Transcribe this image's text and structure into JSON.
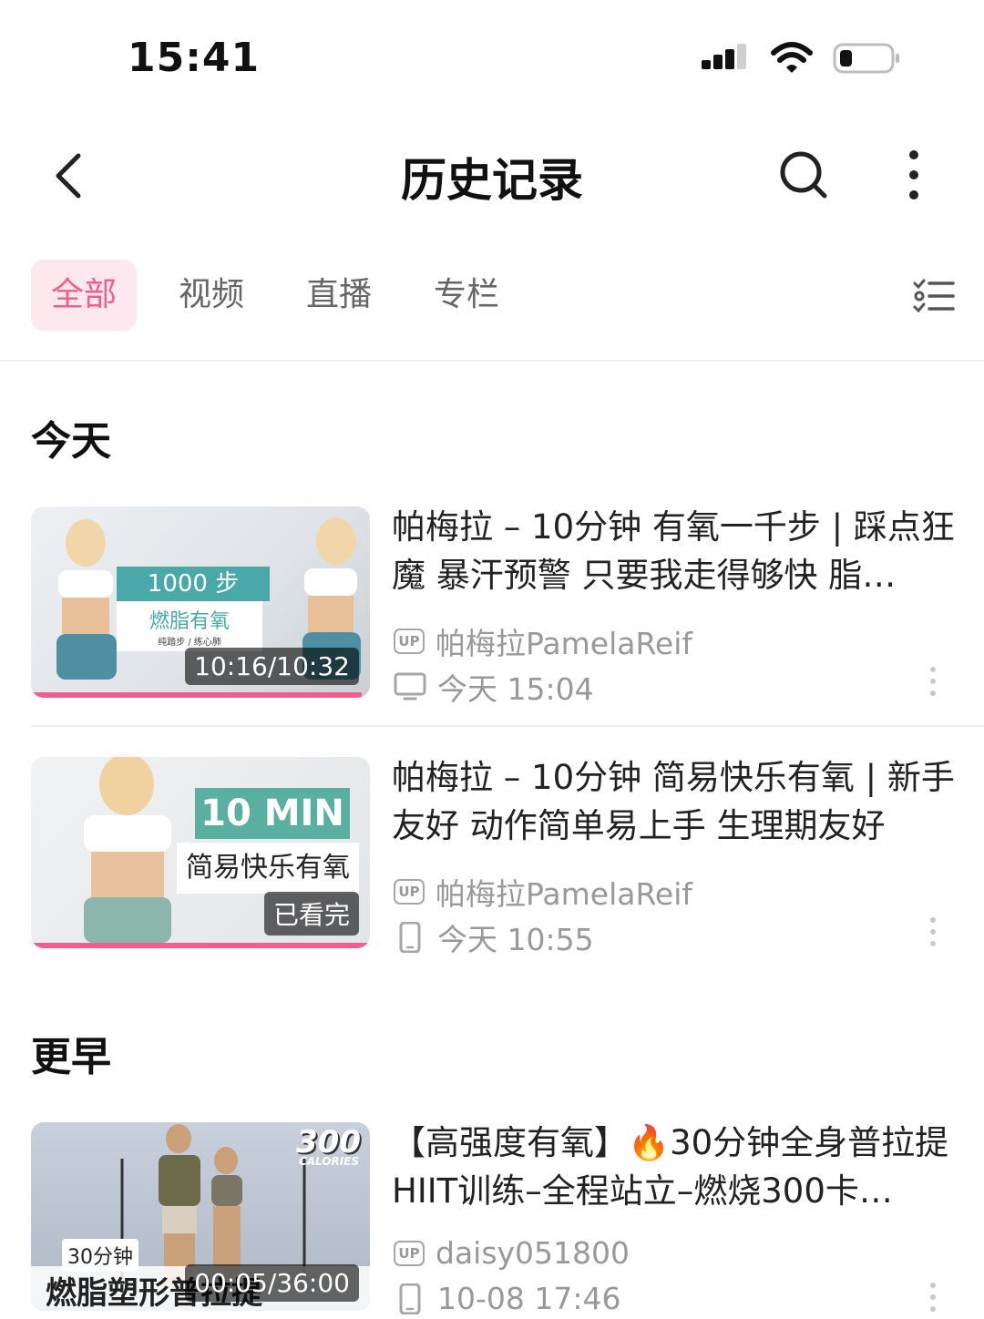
{
  "status": {
    "time": "15:41"
  },
  "nav": {
    "title": "历史记录"
  },
  "tabs": [
    "全部",
    "视频",
    "直播",
    "专栏"
  ],
  "sections": {
    "today": "今天",
    "earlier": "更早"
  },
  "items": [
    {
      "title": "帕梅拉 – 10分钟 有氧一千步 | 踩点狂魔 暴汗预警 只要我走得够快 脂…",
      "author": "帕梅拉PamelaReif",
      "time": "今天 15:04",
      "device": "tv",
      "badge": "10:16/10:32",
      "thumb_text_1": "1000 步",
      "thumb_text_2": "燃脂有氧",
      "thumb_text_3": "纯踏步 / 练心肺",
      "progress": 0.975
    },
    {
      "title": "帕梅拉 – 10分钟 简易快乐有氧 | 新手友好 动作简单易上手 生理期友好",
      "author": "帕梅拉PamelaReif",
      "time": "今天 10:55",
      "device": "phone",
      "badge": "已看完",
      "thumb_text_1": "10 MIN",
      "thumb_text_2": "简易快乐有氧",
      "progress": 1.0
    },
    {
      "title": "【高强度有氧】🔥30分钟全身普拉提HIIT训练–全程站立–燃烧300卡…",
      "author": "daisy051800",
      "time": "10-08 17:46",
      "device": "phone",
      "badge": "00:05/36:00",
      "thumb_text_1": "300",
      "thumb_text_2": "CALORIES",
      "thumb_text_3": "30分钟",
      "thumb_text_4": "燃脂塑形普拉提",
      "progress": 0.003
    }
  ],
  "colors": {
    "accent": "#f25d8e",
    "tab_active_bg": "#fde8ee"
  }
}
